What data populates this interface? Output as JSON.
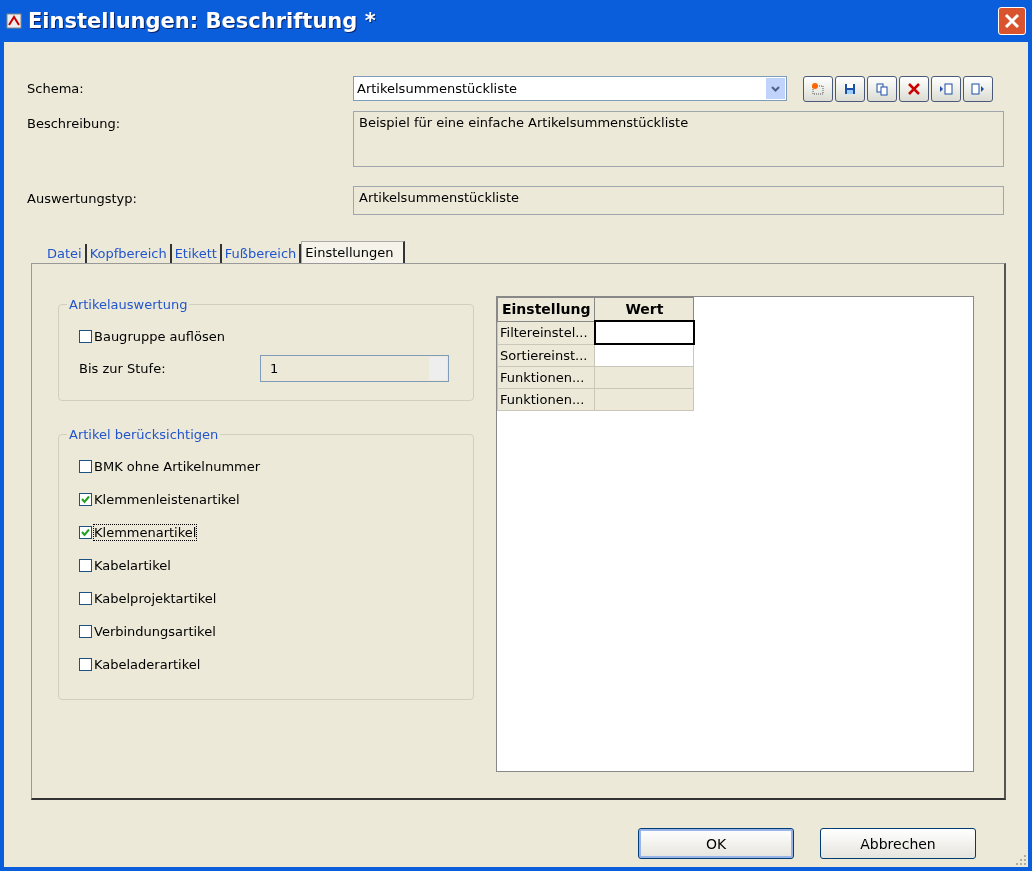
{
  "window": {
    "title": "Einstellungen: Beschriftung *"
  },
  "schema": {
    "label": "Schema:",
    "value": "Artikelsummenstückliste"
  },
  "toolbar": [
    {
      "kind": "new"
    },
    {
      "kind": "save"
    },
    {
      "kind": "copy"
    },
    {
      "kind": "delete"
    },
    {
      "kind": "import"
    },
    {
      "kind": "export"
    }
  ],
  "description": {
    "label": "Beschreibung:",
    "value": "Beispiel für eine einfache Artikelsummenstückliste"
  },
  "evaluation_type": {
    "label": "Auswertungstyp:",
    "value": "Artikelsummenstückliste"
  },
  "tabs": [
    {
      "label": "Datei",
      "selected": false
    },
    {
      "label": "Kopfbereich",
      "selected": false
    },
    {
      "label": "Etikett",
      "selected": false
    },
    {
      "label": "Fußbereich",
      "selected": false
    },
    {
      "label": "Einstellungen",
      "selected": true
    }
  ],
  "group_evaluation": {
    "title": "Artikelauswertung",
    "checkbox": {
      "label": "Baugruppe auflösen",
      "checked": false
    },
    "level_label": "Bis zur Stufe:",
    "level_value": "1"
  },
  "group_articles": {
    "title": "Artikel berücksichtigen",
    "items": [
      {
        "label": "BMK ohne Artikelnummer",
        "checked": false,
        "focused": false
      },
      {
        "label": "Klemmenleistenartikel",
        "checked": true,
        "focused": false
      },
      {
        "label": "Klemmenartikel",
        "checked": true,
        "focused": true
      },
      {
        "label": "Kabelartikel",
        "checked": false,
        "focused": false
      },
      {
        "label": "Kabelprojektartikel",
        "checked": false,
        "focused": false
      },
      {
        "label": "Verbindungsartikel",
        "checked": false,
        "focused": false
      },
      {
        "label": "Kabeladerartikel",
        "checked": false,
        "focused": false
      }
    ]
  },
  "grid": {
    "columns": [
      "Einstellung",
      "Wert"
    ],
    "rows": [
      {
        "name": "Filtereinstel...",
        "editable": true,
        "focused": true
      },
      {
        "name": "Sortiereinst...",
        "editable": true,
        "focused": false
      },
      {
        "name": "Funktionen...",
        "editable": false,
        "focused": false
      },
      {
        "name": "Funktionen...",
        "editable": false,
        "focused": false
      }
    ]
  },
  "buttons": [
    {
      "label": "OK",
      "default": true
    },
    {
      "label": "Abbrechen",
      "default": false
    }
  ]
}
